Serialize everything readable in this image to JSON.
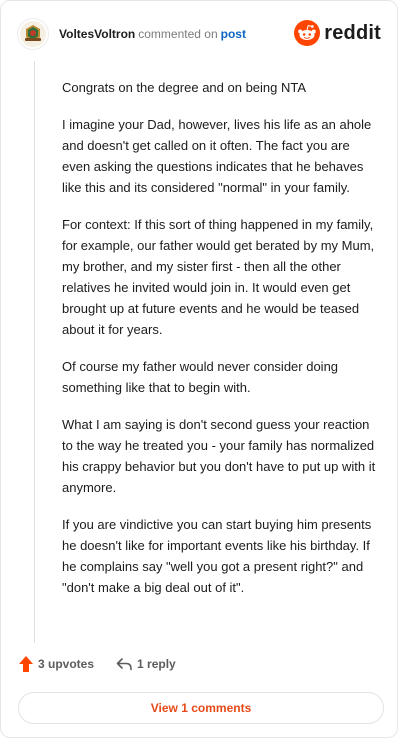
{
  "comment": {
    "username": "VoltesVoltron",
    "action_text": "commented on",
    "post_link": "post",
    "paragraphs": [
      "Congrats on the degree and on being NTA",
      "I imagine your Dad, however, lives his life as an ahole and doesn't get called on it often. The fact you are even asking the questions indicates that he behaves like this and its considered \"normal\" in your family.",
      "For context: If this sort of thing happened in my family, for example, our father would get berated by my Mum, my brother, and my sister first - then all the other relatives he invited would join in. It would even get brought up at future events and he would be teased about it for years.",
      "Of course my father would never consider doing something like that to begin with.",
      "What I am saying is don't second guess your reaction to the way he treated you - your family has normalized his crappy behavior but you don't have to put up with it anymore.",
      "If you are vindictive you can start buying him presents he doesn't like for important events like his birthday. If he complains say \"well you got a present right?\" and \"don't make a big deal out of it\"."
    ],
    "upvotes_label": "3 upvotes",
    "reply_label": "1 reply"
  },
  "brand": {
    "name": "reddit",
    "icon": "reddit-logo-icon",
    "color": "#ff4500"
  },
  "footer": {
    "view_comments_label": "View 1 comments"
  },
  "colors": {
    "accent": "#e64a19",
    "link": "#0a66c2",
    "upvote": "#ff4500"
  }
}
